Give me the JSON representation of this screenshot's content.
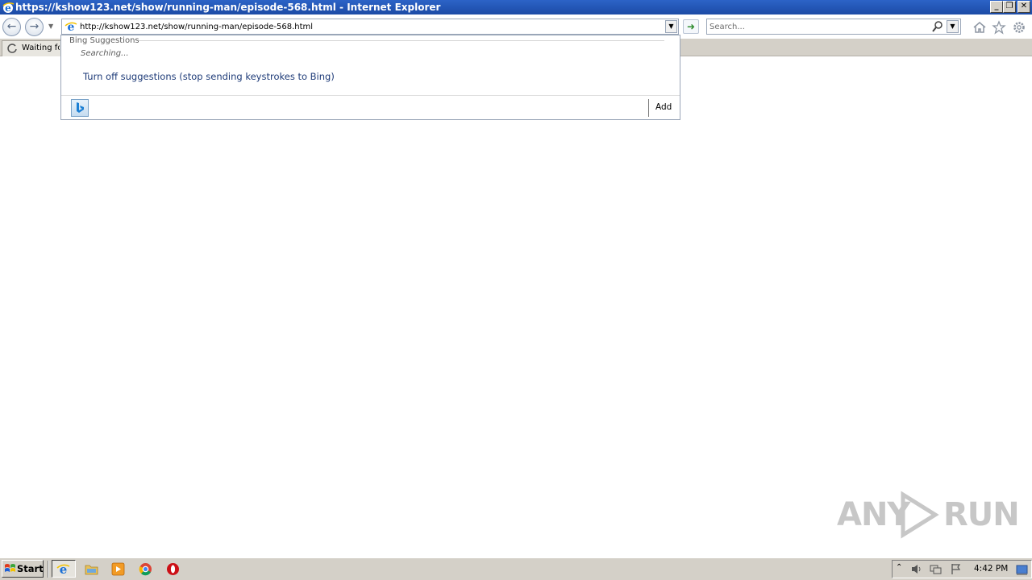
{
  "window": {
    "title": "https://kshow123.net/show/running-man/episode-568.html - Internet Explorer",
    "minimize_glyph": "0",
    "restore_glyph": "❐",
    "close_glyph": "✕"
  },
  "navigation": {
    "back_glyph": "←",
    "forward_glyph": "→",
    "address_value": "http://kshow123.net/show/running-man/episode-568.html",
    "go_glyph": "➜",
    "search_placeholder": "Search..."
  },
  "tab": {
    "label": "Waiting for"
  },
  "suggestions": {
    "header": "Bing Suggestions",
    "status": "Searching...",
    "turn_off_link": "Turn off suggestions (stop sending keystrokes to Bing)",
    "add_label": "Add",
    "bing_icon": "bing-icon"
  },
  "watermark": {
    "left": "ANY",
    "right": "RUN"
  },
  "taskbar": {
    "start_label": "Start",
    "clock": "4:42 PM",
    "apps": [
      "ie-icon",
      "folder-icon",
      "media-player-icon",
      "chrome-icon",
      "opera-icon"
    ]
  },
  "colors": {
    "titlebar": "#2c63c7",
    "taskbar": "#d4d0c8",
    "link": "#1e3b78"
  }
}
